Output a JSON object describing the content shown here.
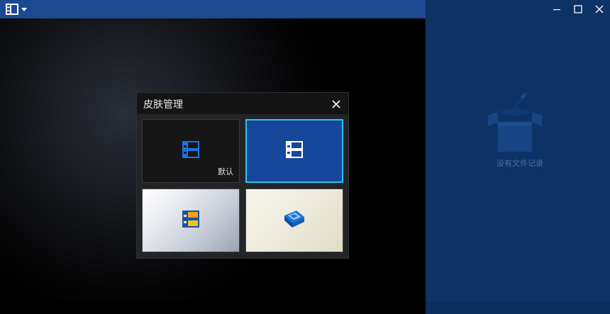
{
  "app": {
    "menu_icon": "film-icon",
    "dropdown_icon": "caret-down-icon"
  },
  "window_controls": {
    "minimize_icon": "minimize-icon",
    "maximize_icon": "maximize-icon",
    "close_icon": "close-icon"
  },
  "playlist": {
    "empty_icon": "empty-box-icon",
    "empty_text": "没有文件记录"
  },
  "skin_dialog": {
    "title": "皮肤管理",
    "close_icon": "close-icon",
    "skins": [
      {
        "label": "默认",
        "icon": "film-icon",
        "selected": false
      },
      {
        "label": "",
        "icon": "film-icon",
        "selected": true
      },
      {
        "label": "",
        "icon": "film-color-icon",
        "selected": false
      },
      {
        "label": "",
        "icon": "film-3d-icon",
        "selected": false
      }
    ]
  },
  "colors": {
    "titlebar": "#1b4a92",
    "panel": "#0d3366",
    "selection_border": "#27c6f0",
    "accent_blue": "#1a73e8"
  }
}
